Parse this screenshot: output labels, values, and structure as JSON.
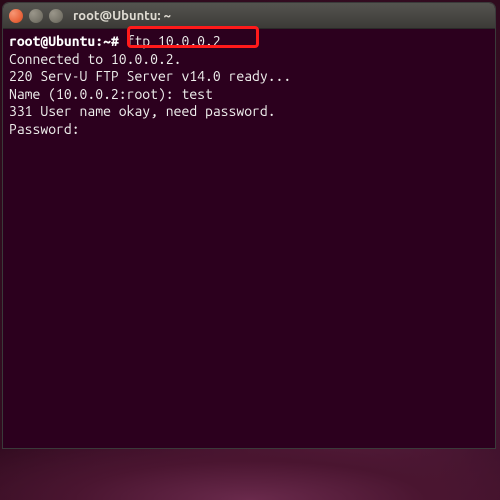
{
  "titlebar": {
    "title": "root@Ubuntu: ~"
  },
  "prompt": {
    "user_host": "root@Ubuntu",
    "separator": ":",
    "path": "~",
    "symbol": "#",
    "command": "ftp 10.0.0.2"
  },
  "output": {
    "line1": "Connected to 10.0.0.2.",
    "line2": "220 Serv-U FTP Server v14.0 ready...",
    "line3_label": "Name (10.0.0.2:root): ",
    "line3_input": "test",
    "line4": "331 User name okay, need password.",
    "line5": "Password:"
  },
  "icons": {
    "close": "×",
    "minimize": "−",
    "maximize": "▢"
  }
}
